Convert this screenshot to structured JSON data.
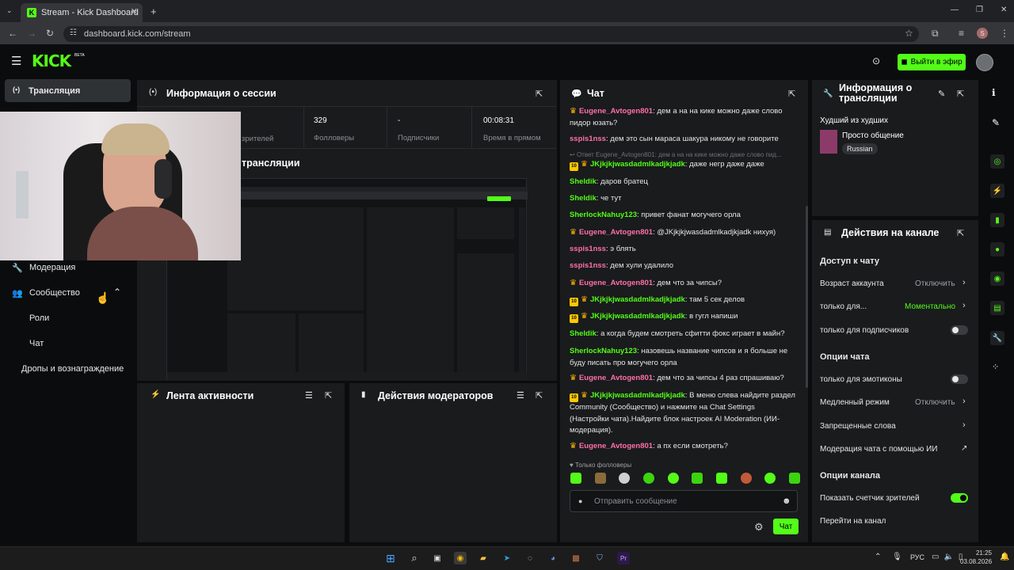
{
  "browser": {
    "tab_title": "Stream - Kick Dashboard",
    "url": "dashboard.kick.com/stream",
    "profile_initial": "S"
  },
  "header": {
    "logo": "KICK",
    "beta": "BETA",
    "go_live": "Выйти в эфир"
  },
  "nav": {
    "active": "Трансляция",
    "moderation": "Модерация",
    "community": "Сообщество",
    "roles": "Роли",
    "chat": "Чат",
    "drops": "Дропы и вознаграждение"
  },
  "session": {
    "title": "Информация о сессии",
    "stats": [
      {
        "value": "",
        "label": "зрителей"
      },
      {
        "value": "329",
        "label": "Фолловеры"
      },
      {
        "value": "-",
        "label": "Подписчики"
      },
      {
        "value": "00:08:31",
        "label": "Время в прямом"
      }
    ],
    "preview_title": "трансляции"
  },
  "activity": {
    "title": "Лента активности"
  },
  "modactions": {
    "title": "Действия модераторов"
  },
  "chat": {
    "title": "Чат",
    "reply_hint": "Ответ Eugene_Avtogen801: дем а на на кике можно даже слово пид...",
    "messages": [
      {
        "user": "Eugene_Avtogen801",
        "text": ": дем а на на кике можно даже слово пидор юзать?",
        "color": "pink",
        "crown": true,
        "sub": false
      },
      {
        "user": "sspis1nss",
        "text": ": дем это сын мараса шакура никому не говорите",
        "color": "pink",
        "crown": false,
        "sub": false
      },
      {
        "user": "JKjkjkjwasdadmlkadjkjadk",
        "text": ": даже негр даже даже",
        "color": "green",
        "crown": true,
        "sub": true
      },
      {
        "user": "Sheldik",
        "text": ": даров братец",
        "color": "green",
        "crown": false,
        "sub": false
      },
      {
        "user": "Sheldik",
        "text": ": че тут",
        "color": "green",
        "crown": false,
        "sub": false
      },
      {
        "user": "SherlockNahuy123",
        "text": ": привет фанат могучего орла",
        "color": "green",
        "crown": false,
        "sub": false
      },
      {
        "user": "Eugene_Avtogen801",
        "text": ": @JKjkjkjwasdadmlkadjkjadk нихуя)",
        "color": "pink",
        "crown": true,
        "sub": false
      },
      {
        "user": "sspis1nss",
        "text": ": э блять",
        "color": "pink",
        "crown": false,
        "sub": false
      },
      {
        "user": "sspis1nss",
        "text": ": дем хули удалило",
        "color": "pink",
        "crown": false,
        "sub": false
      },
      {
        "user": "Eugene_Avtogen801",
        "text": ": дем что за чипсы?",
        "color": "pink",
        "crown": true,
        "sub": false
      },
      {
        "user": "JKjkjkjwasdadmlkadjkjadk",
        "text": ": там 5 сек делов",
        "color": "green",
        "crown": true,
        "sub": true
      },
      {
        "user": "JKjkjkjwasdadmlkadjkjadk",
        "text": ": в гугл напиши",
        "color": "green",
        "crown": true,
        "sub": true
      },
      {
        "user": "Sheldik",
        "text": ": а когда будем смотреть сфитти фокс играет в майн?",
        "color": "green",
        "crown": false,
        "sub": false
      },
      {
        "user": "SherlockNahuy123",
        "text": ": назовешь название чипсов и я больше не буду писать про могучего орла",
        "color": "green",
        "crown": false,
        "sub": false
      },
      {
        "user": "Eugene_Avtogen801",
        "text": ": дем что за чипсы 4 раз спрашиваю?",
        "color": "pink",
        "crown": true,
        "sub": false
      },
      {
        "user": "JKjkjkjwasdadmlkadjkjadk",
        "text": ": В меню слева найдите раздел Community (Сообщество) и нажмите на Chat Settings (Настройки чата).Найдите блок настроек AI Moderation (ИИ-модерация).",
        "color": "green",
        "crown": true,
        "sub": true
      },
      {
        "user": "Eugene_Avtogen801",
        "text": ": а пх если смотреть?",
        "color": "pink",
        "crown": true,
        "sub": false
      }
    ],
    "sub_badge": "10",
    "followers_only": "Только фолловеры",
    "input_placeholder": "Отправить сообщение",
    "send": "Чат"
  },
  "info": {
    "title": "Информация о трансляции",
    "stream_title": "Худший из худших",
    "category": "Просто общение",
    "language": "Russian"
  },
  "channel": {
    "title": "Действия на канале",
    "chat_access": "Доступ к чату",
    "account_age": "Возраст аккаунта",
    "account_age_val": "Отключить",
    "followers_only": "только для...",
    "followers_only_val": "Моментально",
    "subs_only": "только для подписчиков",
    "chat_options": "Опции чата",
    "emotes_only": "только для эмотиконы",
    "slow_mode": "Медленный режим",
    "slow_mode_val": "Отключить",
    "banned_words": "Запрещенные слова",
    "ai_mod": "Модерация чата с помощью ИИ",
    "channel_options": "Опции канала",
    "viewer_count": "Показать счетчик зрителей",
    "go_channel": "Перейти на канал"
  },
  "taskbar": {
    "lang": "РУС",
    "time": "21:25",
    "date": "03.08.2026"
  },
  "colors": {
    "accent": "#53fc18",
    "panel": "#191b1d",
    "bg": "#0b0c0d"
  }
}
